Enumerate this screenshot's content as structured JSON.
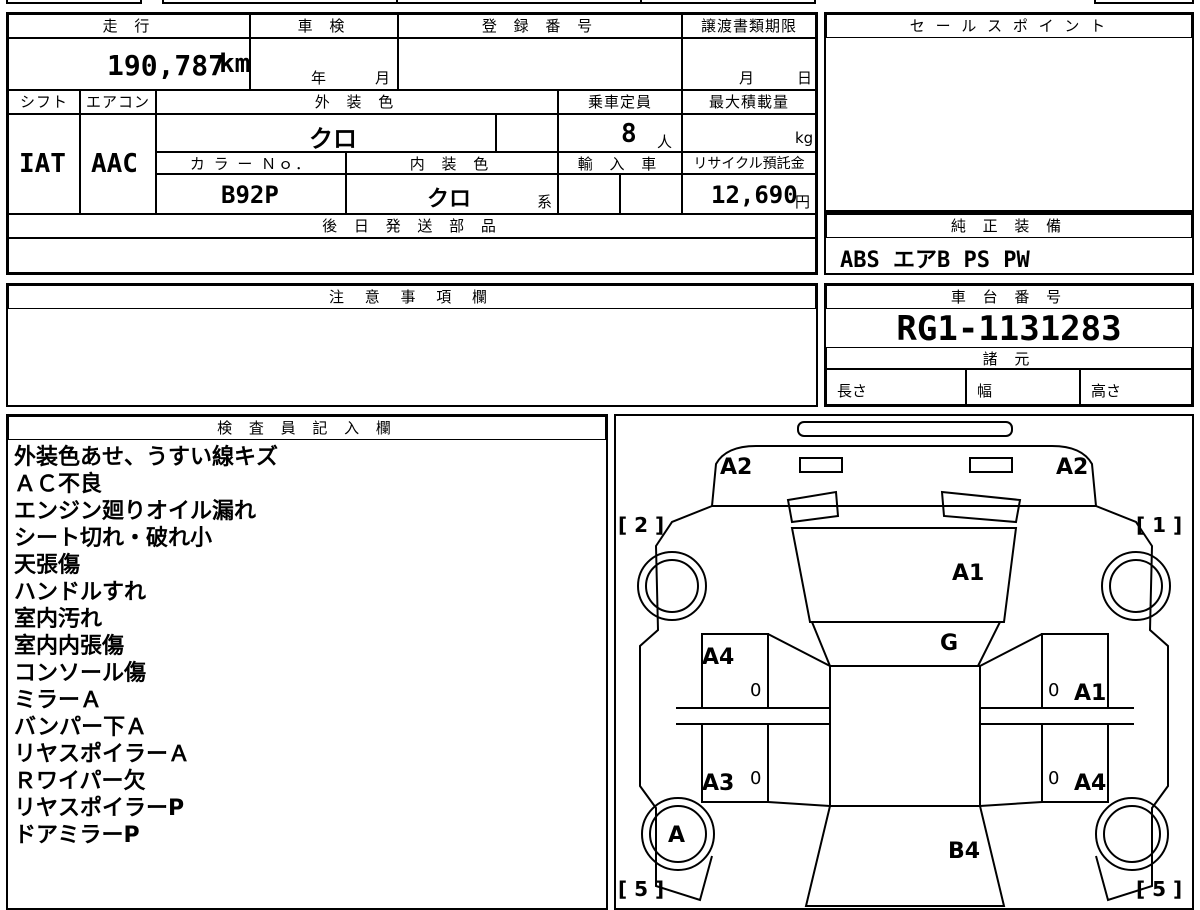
{
  "sheet": {
    "mileage": {
      "label": "走 行",
      "value": "190,787",
      "unit": "km"
    },
    "inspection": {
      "label": "車 検",
      "year": "年",
      "month": "月"
    },
    "registration": {
      "label": "登 録 番 号",
      "value": ""
    },
    "transfer": {
      "label": "譲渡書類期限",
      "month": "月",
      "day": "日"
    },
    "shift": {
      "label": "シフト",
      "value": "IAT"
    },
    "aircon": {
      "label": "エアコン",
      "value": "AAC"
    },
    "exterior_color": {
      "label": "外 装 色",
      "value": "クロ"
    },
    "capacity": {
      "label": "乗車定員",
      "value": "8",
      "unit": "人"
    },
    "max_load": {
      "label": "最大積載量",
      "value": "",
      "unit": "kg"
    },
    "color_no": {
      "label": "カ ラ ー Ｎｏ．",
      "value": "B92P"
    },
    "interior_color": {
      "label": "内 装 色",
      "value": "クロ",
      "suffix": "系"
    },
    "import": {
      "label": "輸 入 車",
      "value": ""
    },
    "recycle": {
      "label": "リサイクル預託金",
      "value": "12,690",
      "unit": "円"
    },
    "later_parts": {
      "label": "後 日 発 送 部 品",
      "value": ""
    }
  },
  "sales_point": {
    "label": "セ ー ル ス ポ イ ン ト",
    "value": ""
  },
  "standard_equipment": {
    "label": "純 正 装 備",
    "value": "ABS エアB PS PW"
  },
  "caution": {
    "label": "注 意 事 項 欄",
    "value": ""
  },
  "chassis": {
    "label": "車 台 番 号",
    "value": "RG1-1131283"
  },
  "specs": {
    "label": "諸 元",
    "length": "長さ",
    "width": "幅",
    "height": "高さ"
  },
  "inspector": {
    "label": "検 査 員 記 入 欄",
    "notes": [
      "外装色あせ、うすい線キズ",
      "ＡＣ不良",
      "エンジン廻りオイル漏れ",
      "シート切れ・破れ小",
      "天張傷",
      "ハンドルすれ",
      "室内汚れ",
      "室内内張傷",
      "コンソール傷",
      "ミラーＡ",
      "バンパー下Ａ",
      "リヤスポイラーＡ",
      "Ｒワイパー欠",
      "リヤスポイラーP",
      "ドアミラーP"
    ]
  },
  "diagram": {
    "front_bumper": "A2",
    "front_bumper_right": "A2",
    "hood": "A1",
    "windshield": "G",
    "left_front_door": "A4",
    "left_rear_door": "A3",
    "right_front_door": "A1",
    "right_rear_door": "A4",
    "roof": "B4",
    "wheel": "A",
    "door_zero_1": "0",
    "door_zero_2": "0",
    "door_zero_3": "0",
    "door_zero_4": "0",
    "mark_top_left": "[ 2 ]",
    "mark_top_right": "[ 1 ]",
    "mark_bottom_left": "[ 5 ]",
    "mark_bottom_right": "[ 5 ]"
  }
}
